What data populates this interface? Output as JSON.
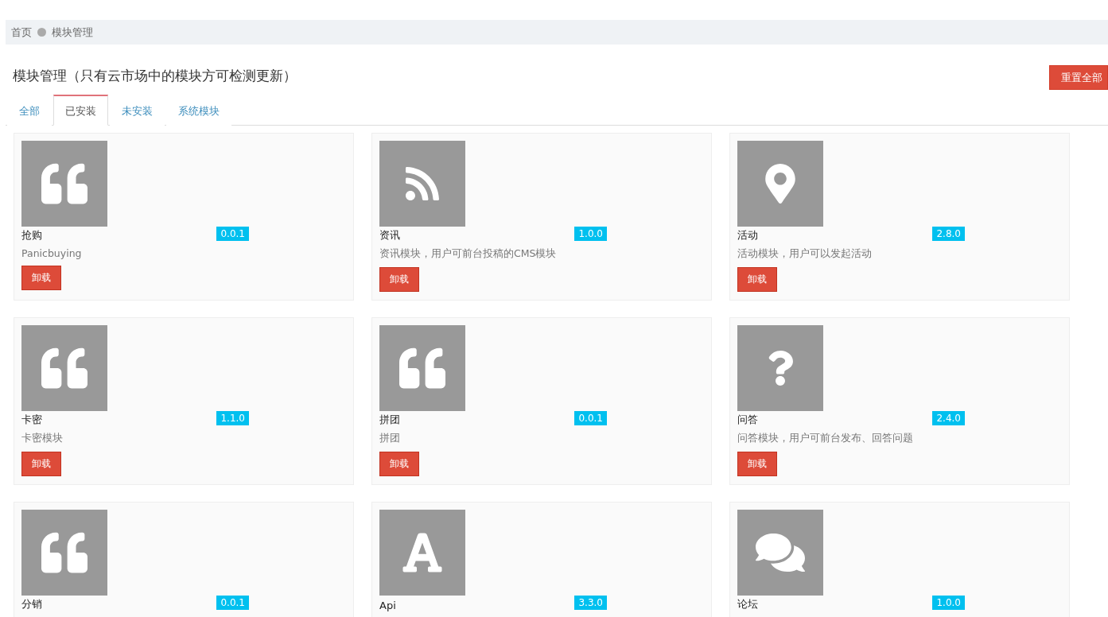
{
  "breadcrumb": [
    {
      "label": "首页"
    },
    {
      "label": "模块管理"
    }
  ],
  "title": "模块管理（只有云市场中的模块方可检测更新）",
  "reset_button": "重置全部",
  "tabs": [
    {
      "label": "全部",
      "selected": false
    },
    {
      "label": "已安装",
      "selected": true
    },
    {
      "label": "未安装",
      "selected": false
    },
    {
      "label": "系统模块",
      "selected": false
    }
  ],
  "modules": [
    {
      "kind": "quote",
      "name": "抢购",
      "version": "0.0.1",
      "description": "Panicbuying",
      "action": "卸载"
    },
    {
      "kind": "rss",
      "name": "资讯",
      "version": "1.0.0",
      "description": "资讯模块，用户可前台投稿的CMS模块",
      "action": "卸载"
    },
    {
      "kind": "pin",
      "name": "活动",
      "version": "2.8.0",
      "description": "活动模块，用户可以发起活动",
      "action": "卸载"
    },
    {
      "kind": "quote",
      "name": "卡密",
      "version": "1.1.0",
      "description": "卡密模块",
      "action": "卸载"
    },
    {
      "kind": "quote",
      "name": "拼团",
      "version": "0.0.1",
      "description": "拼团",
      "action": "卸载"
    },
    {
      "kind": "question",
      "name": "问答",
      "version": "2.4.0",
      "description": "问答模块，用户可前台发布、回答问题",
      "action": "卸载"
    },
    {
      "kind": "quote",
      "name": "分销",
      "version": "0.0.1"
    },
    {
      "kind": "letter",
      "name": "Api",
      "version": "3.3.0"
    },
    {
      "kind": "chat",
      "name": "论坛",
      "version": "1.0.0"
    }
  ]
}
